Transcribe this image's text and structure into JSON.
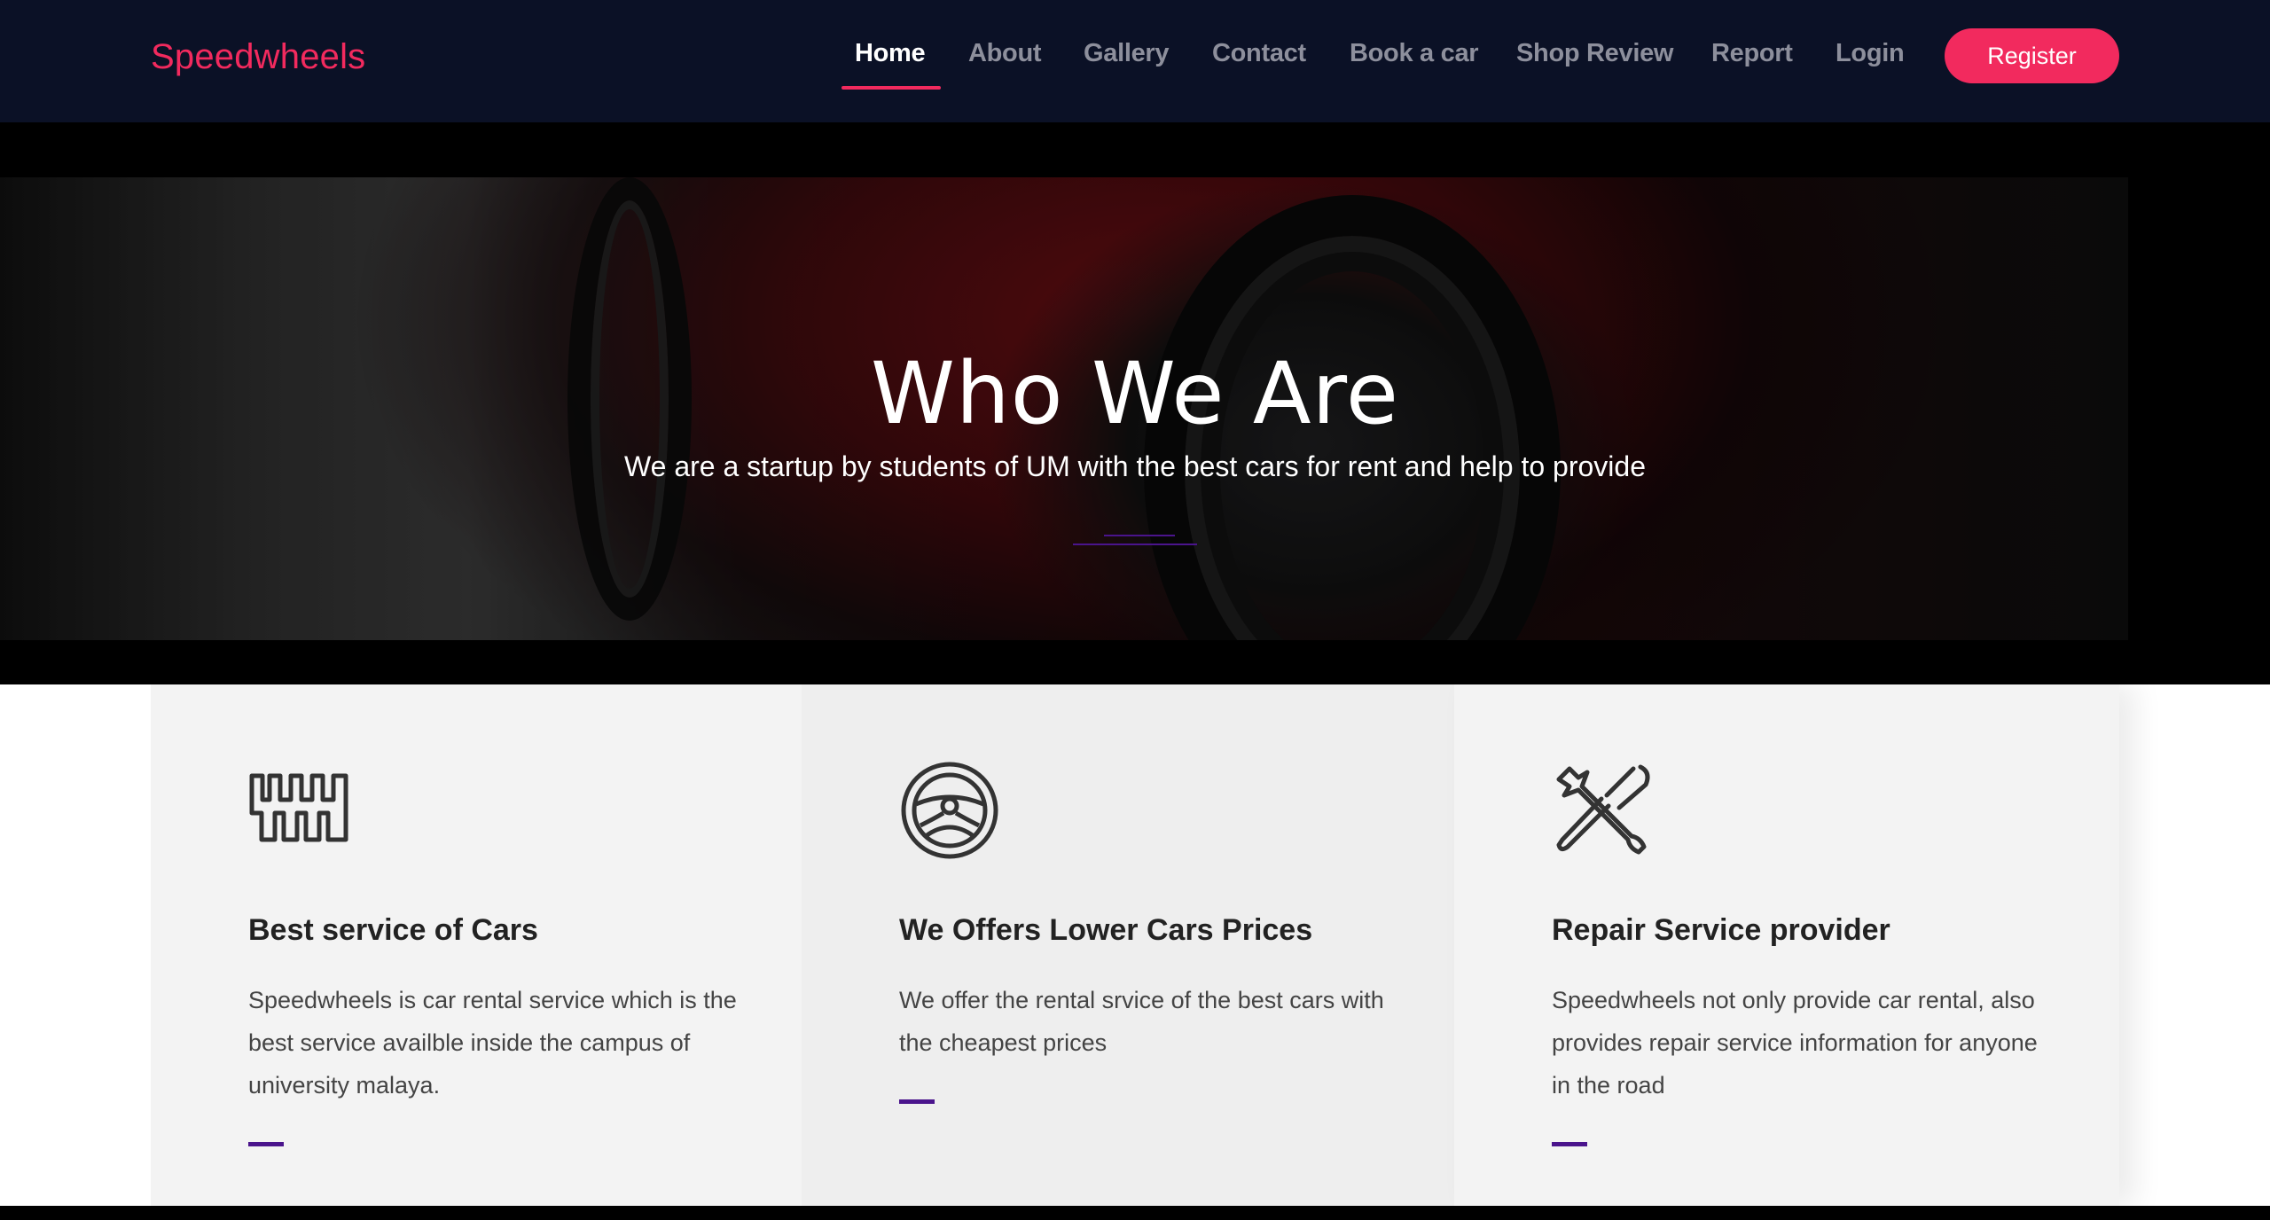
{
  "brand": "Speedwheels",
  "nav": {
    "items": [
      "Home",
      "About",
      "Gallery",
      "Contact",
      "Book a car",
      "Shop Review",
      "Report",
      "Login"
    ],
    "active": "Home",
    "register_label": "Register"
  },
  "hero": {
    "title": "Who We Are",
    "subtitle": "We are a startup by students of UM with the best cars for rent and help to provide"
  },
  "features": [
    {
      "icon": "gear-shift-icon",
      "title": "Best service of Cars",
      "text": "Speedwheels is car rental service which is the best service availble inside the campus of university malaya."
    },
    {
      "icon": "steering-wheel-icon",
      "title": "We Offers Lower Cars Prices",
      "text": "We offer the rental srvice of the best cars with the cheapest prices"
    },
    {
      "icon": "wrench-screwdriver-icon",
      "title": "Repair Service provider",
      "text": "Speedwheels not only provide car rental, also provides repair service information for anyone in the road"
    }
  ],
  "colors": {
    "navbar_bg": "#0b1126",
    "accent": "#f22a5e",
    "divider_purple": "#4a148c"
  }
}
